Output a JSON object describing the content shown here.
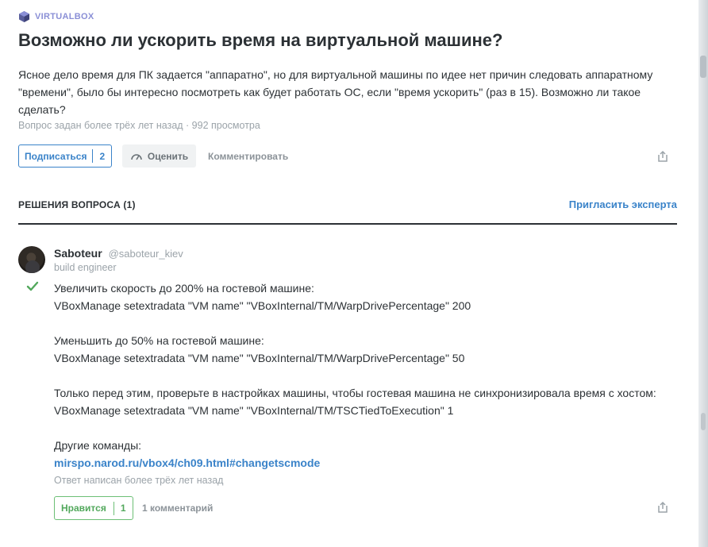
{
  "tag": {
    "label": "VIRTUALBOX",
    "icon": "virtualbox-cube-icon"
  },
  "question": {
    "title": "Возможно ли ускорить время на виртуальной машине?",
    "body": "Ясное дело время для ПК задается \"аппаратно\", но для виртуальной машины по идее нет причин следовать аппаратному \"времени\", было бы интересно посмотреть как будет работать ОС, если \"время ускорить\" (раз в 15). Возможно ли такое сделать?",
    "meta": "Вопрос задан более трёх лет назад · 992 просмотра",
    "subscribe_label": "Подписаться",
    "subscribe_count": "2",
    "rate_label": "Оценить",
    "comment_label": "Комментировать"
  },
  "answers_section": {
    "title": "РЕШЕНИЯ ВОПРОСА (1)",
    "invite_label": "Пригласить эксперта"
  },
  "answer": {
    "author_name": "Saboteur",
    "author_nick": "@saboteur_kiev",
    "author_role": "build engineer",
    "lines": {
      "l1": "Увеличить скорость до 200% на гостевой машине:",
      "l2": "VBoxManage setextradata \"VM name\" \"VBoxInternal/TM/WarpDrivePercentage\" 200",
      "l3": "Уменьшить до 50% на гостевой машине:",
      "l4": "VBoxManage setextradata \"VM name\" \"VBoxInternal/TM/WarpDrivePercentage\" 50",
      "l5": "Только перед этим, проверьте в настройках машины, чтобы гостевая машина не синхронизировала время с хостом:",
      "l6": "VBoxManage setextradata \"VM name\" \"VBoxInternal/TM/TSCTiedToExecution\" 1",
      "l7": "Другие команды:",
      "link": "mirspo.narod.ru/vbox4/ch09.html#changetscmode"
    },
    "meta": "Ответ написан более трёх лет назад",
    "like_label": "Нравится",
    "like_count": "1",
    "comments_label": "1 комментарий"
  },
  "colors": {
    "accent_blue": "#3a83c9",
    "accept_green": "#52a85c",
    "muted": "#9ba3a9",
    "tag_purple": "#8a8fd6"
  }
}
